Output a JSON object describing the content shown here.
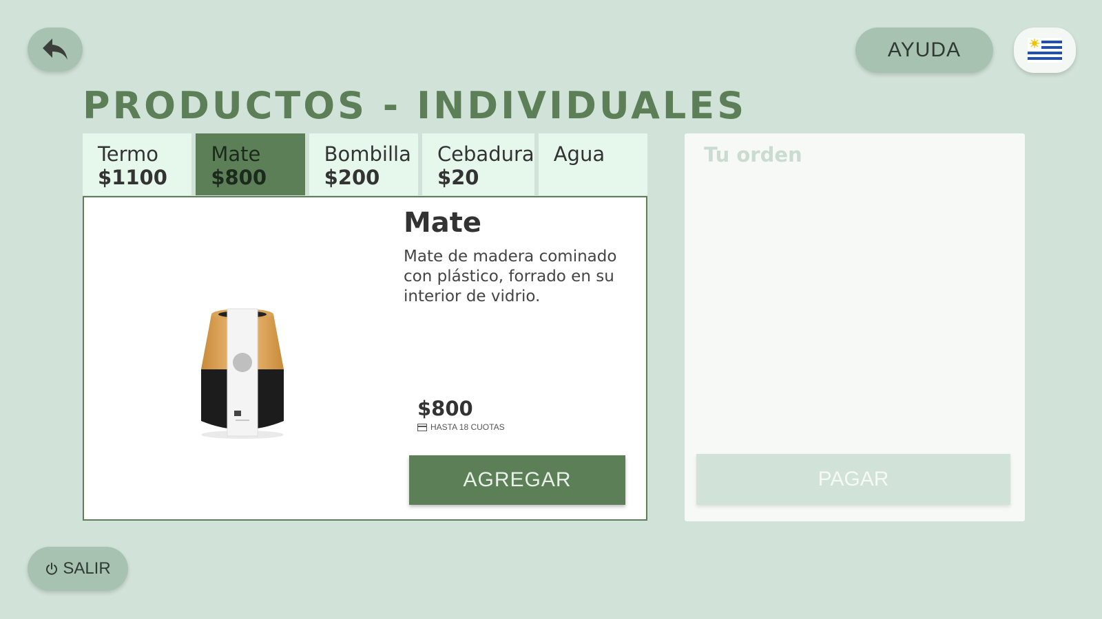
{
  "header": {
    "help_label": "AYUDA",
    "back_icon": "back-arrow-icon",
    "flag_icon": "uruguay-flag-icon"
  },
  "page_title": "PRODUCTOS - INDIVIDUALES",
  "tabs": [
    {
      "name": "Termo",
      "price": "$1100",
      "active": false
    },
    {
      "name": "Mate",
      "price": "$800",
      "active": true
    },
    {
      "name": "Bombilla",
      "price": "$200",
      "active": false
    },
    {
      "name": "Cebadura",
      "price": "$20",
      "active": false
    },
    {
      "name": "Agua",
      "price": "",
      "active": false
    }
  ],
  "product": {
    "title": "Mate",
    "description": "Mate de madera cominado con plástico, forrado en su interior de vidrio.",
    "price": "$800",
    "installments": "HASTA 18 CUOTAS",
    "add_label": "AGREGAR",
    "image": "mate-cup-image"
  },
  "order": {
    "title": "Tu orden",
    "pay_label": "PAGAR"
  },
  "footer": {
    "exit_label": "SALIR",
    "exit_icon": "power-icon"
  },
  "colors": {
    "background": "#d1e2d8",
    "accent": "#5c7f58",
    "button": "#a8c2b1",
    "tab": "#e6f7ec"
  }
}
